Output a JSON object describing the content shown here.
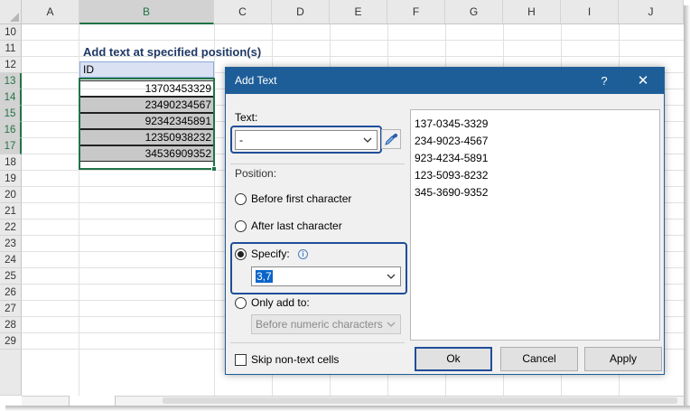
{
  "sheet": {
    "columns": [
      "A",
      "B",
      "C",
      "D",
      "E",
      "F",
      "G",
      "H",
      "I",
      "J"
    ],
    "rows": [
      "10",
      "11",
      "12",
      "13",
      "14",
      "15",
      "16",
      "17",
      "18",
      "19",
      "20",
      "21",
      "22",
      "23",
      "24",
      "25",
      "26",
      "27",
      "28",
      "29"
    ],
    "title": "Add text at specified position(s)",
    "header": "ID",
    "values": [
      "13703453329",
      "23490234567",
      "92342345891",
      "12350938232",
      "34536909352"
    ]
  },
  "dialog": {
    "title": "Add Text",
    "help_label": "?",
    "close_label": "✕",
    "text_label": "Text:",
    "text_value": "-",
    "position_label": "Position:",
    "option_before": "Before first character",
    "option_after": "After last character",
    "option_specify": "Specify:",
    "specify_value": "3,7",
    "option_only": "Only add to:",
    "only_value": "Before numeric characters",
    "skip_label": "Skip non-text cells",
    "preview": [
      "137-0345-3329",
      "234-9023-4567",
      "923-4234-5891",
      "123-5093-8232",
      "345-3690-9352"
    ],
    "ok_label": "Ok",
    "cancel_label": "Cancel",
    "apply_label": "Apply",
    "selected_option": "specify"
  },
  "colors": {
    "title_bar": "#1e5e98",
    "excel_green": "#217346",
    "header_blue": "#d9e1f2",
    "cell_gray": "#c8c8c8",
    "title_text": "#1f3864"
  },
  "icons": {
    "picker": "eyedropper-icon",
    "dropdown": "chevron-down-icon",
    "info": "info-icon",
    "close": "close-icon"
  }
}
